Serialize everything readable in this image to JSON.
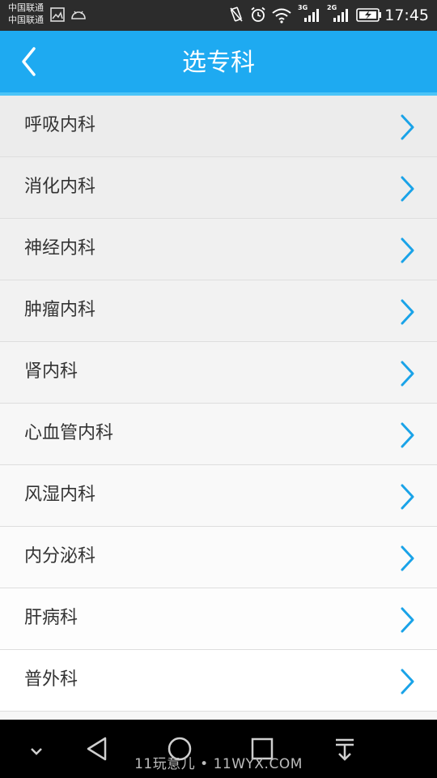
{
  "status_bar": {
    "carrier_1": "中国联通",
    "carrier_2": "中国联通",
    "net_3g": "3G",
    "net_2g": "2G",
    "time": "17:45"
  },
  "header": {
    "title": "选专科"
  },
  "list": {
    "items": [
      {
        "label": "呼吸内科"
      },
      {
        "label": "消化内科"
      },
      {
        "label": "神经内科"
      },
      {
        "label": "肿瘤内科"
      },
      {
        "label": "肾内科"
      },
      {
        "label": "心血管内科"
      },
      {
        "label": "风湿内科"
      },
      {
        "label": "内分泌科"
      },
      {
        "label": "肝病科"
      },
      {
        "label": "普外科"
      }
    ]
  },
  "watermark": "11玩意儿 • 11WYX.COM",
  "colors": {
    "accent": "#1eaaf1",
    "chevron": "#1aa3e8"
  }
}
